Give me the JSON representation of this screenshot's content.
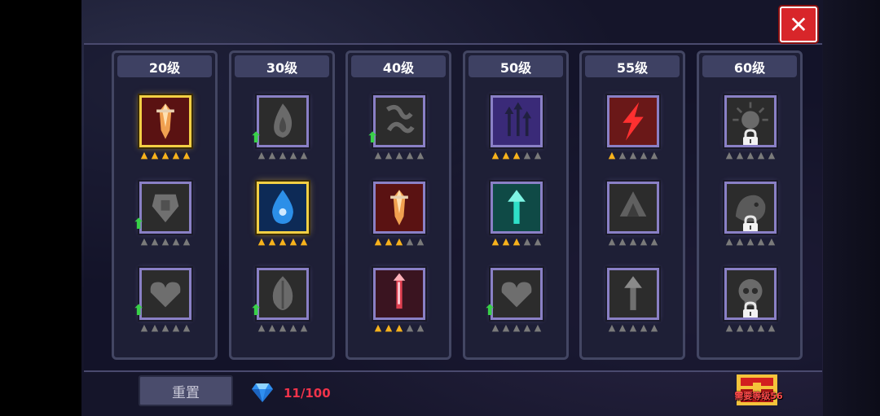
{
  "close_label": "✕",
  "columns": [
    {
      "level": "20级",
      "skills": [
        {
          "name": "red-crystal-icon",
          "stars": 5,
          "gold": true,
          "upgrade": false,
          "locked": false
        },
        {
          "name": "gray-shield-icon",
          "stars": 0,
          "gold": false,
          "upgrade": true,
          "locked": false
        },
        {
          "name": "gray-heart-icon",
          "stars": 0,
          "gold": false,
          "upgrade": true,
          "locked": false
        }
      ]
    },
    {
      "level": "30级",
      "skills": [
        {
          "name": "gray-flame-icon",
          "stars": 0,
          "gold": false,
          "upgrade": true,
          "locked": false
        },
        {
          "name": "blue-drop-icon",
          "stars": 5,
          "gold": true,
          "upgrade": false,
          "locked": false
        },
        {
          "name": "gray-leaf-icon",
          "stars": 0,
          "gold": false,
          "upgrade": true,
          "locked": false
        }
      ]
    },
    {
      "level": "40级",
      "skills": [
        {
          "name": "gray-chain-icon",
          "stars": 0,
          "gold": false,
          "upgrade": true,
          "locked": false
        },
        {
          "name": "red-crystal-icon",
          "stars": 3,
          "gold": false,
          "upgrade": false,
          "locked": false
        },
        {
          "name": "red-needle-icon",
          "stars": 3,
          "gold": false,
          "upgrade": false,
          "locked": false
        }
      ]
    },
    {
      "level": "50级",
      "skills": [
        {
          "name": "purple-arrows-icon",
          "stars": 3,
          "gold": false,
          "upgrade": false,
          "locked": false
        },
        {
          "name": "teal-arrow-icon",
          "stars": 3,
          "gold": false,
          "upgrade": false,
          "locked": false
        },
        {
          "name": "gray-heart-icon",
          "stars": 0,
          "gold": false,
          "upgrade": true,
          "locked": false
        }
      ]
    },
    {
      "level": "55级",
      "skills": [
        {
          "name": "red-lightning-icon",
          "stars": 1,
          "gold": false,
          "upgrade": false,
          "locked": false
        },
        {
          "name": "gray-horn-icon",
          "stars": 0,
          "gold": false,
          "upgrade": false,
          "locked": false
        },
        {
          "name": "gray-arrow-icon",
          "stars": 0,
          "gold": false,
          "upgrade": false,
          "locked": false
        }
      ]
    },
    {
      "level": "60级",
      "skills": [
        {
          "name": "gray-burst-icon",
          "stars": 0,
          "gold": false,
          "upgrade": false,
          "locked": true
        },
        {
          "name": "gray-beast-icon",
          "stars": 0,
          "gold": false,
          "upgrade": false,
          "locked": true
        },
        {
          "name": "gray-skull-icon",
          "stars": 0,
          "gold": false,
          "upgrade": false,
          "locked": true
        }
      ]
    }
  ],
  "reset_label": "重置",
  "gem_count": "11/100",
  "chest_label": "需要等级56"
}
